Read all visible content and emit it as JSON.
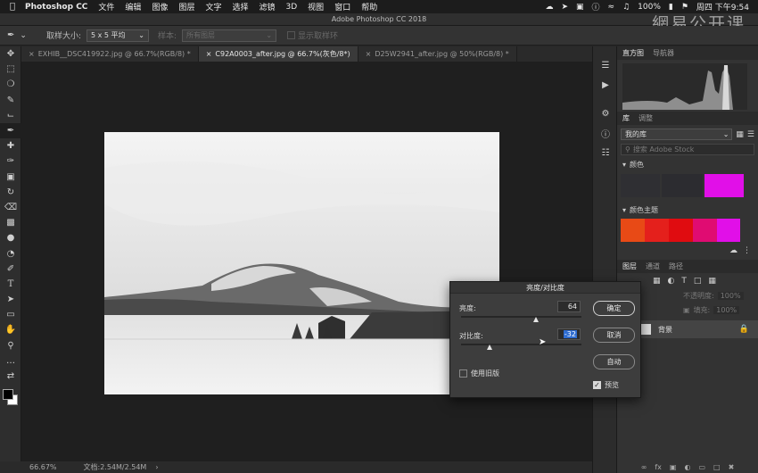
{
  "menubar": {
    "app": "Photoshop CC",
    "items": [
      "文件",
      "编辑",
      "图像",
      "图层",
      "文字",
      "选择",
      "滤镜",
      "3D",
      "视图",
      "窗口",
      "帮助"
    ],
    "battery": "100%",
    "clock": "周四 下午9:54"
  },
  "window_title": "Adobe Photoshop CC 2018",
  "watermark": "網易公开课",
  "options": {
    "sample_size_label": "取样大小:",
    "sample_size_value": "5 x 5 平均",
    "sample_label": "样本:",
    "sample_value": "所有图层",
    "show_ring_label": "显示取样环"
  },
  "tabs": [
    {
      "label": "EXHIB__DSC419922.jpg @ 66.7%(RGB/8) *"
    },
    {
      "label": "C92A0003_after.jpg @ 66.7%(灰色/8*)"
    },
    {
      "label": "D25W2941_after.jpg @ 50%(RGB/8) *"
    }
  ],
  "status": {
    "zoom": "66.67%",
    "doc": "文档:2.54M/2.54M"
  },
  "panels": {
    "histogram_tab": "直方图",
    "navigator_tab": "导航器",
    "library_tab": "库",
    "adjust_tab": "调整",
    "library_select": "我的库",
    "search_placeholder": "搜索 Adobe Stock",
    "colors_section": "颜色",
    "color_theme_section": "颜色主题",
    "layers_tab": "图层",
    "channels_tab": "通道",
    "paths_tab": "路径",
    "opacity_label": "不透明度:",
    "opacity_value": "100%",
    "fill_label": "填充:",
    "fill_value": "100%",
    "layer_name": "背景"
  },
  "colors": {
    "swatch_dark1": "#2f2f33",
    "swatch_dark2": "#2c2c30",
    "swatch_magenta": "#e10fe8",
    "theme": [
      "#e84a16",
      "#e4201c",
      "#e00c10",
      "#e00c72",
      "#e10fe8"
    ]
  },
  "dialog": {
    "title": "亮度/对比度",
    "brightness_label": "亮度:",
    "brightness_value": "64",
    "contrast_label": "对比度:",
    "contrast_value": "-32",
    "legacy_label": "使用旧版",
    "legacy_checked": false,
    "ok_label": "确定",
    "cancel_label": "取消",
    "auto_label": "自动",
    "preview_label": "预览",
    "preview_checked": true,
    "brightness_level": 0.62,
    "contrast_level": 0.24
  }
}
